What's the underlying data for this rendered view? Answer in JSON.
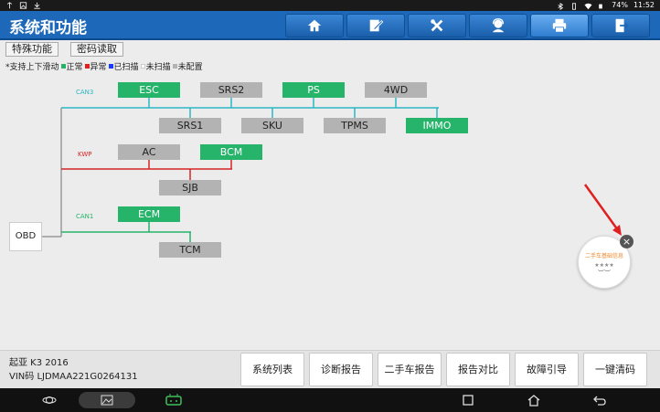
{
  "statusbar": {
    "battery": "74%",
    "time": "11:52"
  },
  "header": {
    "title": "系统和功能",
    "buttons": [
      {
        "icon": "home-icon"
      },
      {
        "icon": "edit-report-icon"
      },
      {
        "icon": "tools-icon"
      },
      {
        "icon": "support-agent-icon"
      },
      {
        "icon": "print-icon"
      },
      {
        "icon": "exit-icon"
      }
    ]
  },
  "tabs": {
    "special": "特殊功能",
    "code_read": "密码读取"
  },
  "legend": {
    "scroll": "*支持上下滑动",
    "normal": "正常",
    "abnormal": "异常",
    "scanned": "已扫描",
    "not_scanned": "未扫描",
    "not_configured": "未配置",
    "colors": {
      "normal": "#26b36a",
      "abnormal": "#e02020",
      "scanned": "#1a3cff",
      "not_configured": "#b3b3b3"
    }
  },
  "diagram": {
    "obd": "OBD",
    "buses": {
      "can3": {
        "label": "CAN3",
        "color": "#2bb6c4"
      },
      "kwp": {
        "label": "KWP",
        "color": "#d42424"
      },
      "can1": {
        "label": "CAN1",
        "color": "#26b36a"
      }
    },
    "modules": {
      "esc": {
        "label": "ESC",
        "status": "ok"
      },
      "srs2": {
        "label": "SRS2",
        "status": "na"
      },
      "ps": {
        "label": "PS",
        "status": "ok"
      },
      "fourwd": {
        "label": "4WD",
        "status": "na"
      },
      "srs1": {
        "label": "SRS1",
        "status": "na"
      },
      "sku": {
        "label": "SKU",
        "status": "na"
      },
      "tpms": {
        "label": "TPMS",
        "status": "na"
      },
      "immo": {
        "label": "IMMO",
        "status": "ok"
      },
      "ac": {
        "label": "AC",
        "status": "na"
      },
      "bcm": {
        "label": "BCM",
        "status": "ok"
      },
      "sjb": {
        "label": "SJB",
        "status": "na"
      },
      "ecm": {
        "label": "ECM",
        "status": "ok"
      },
      "tcm": {
        "label": "TCM",
        "status": "na"
      }
    }
  },
  "float_widget": {
    "text": "二手车基础信息",
    "stars": "★★★★",
    "eye": "︶︶"
  },
  "vehicle": {
    "model": "起亚 K3 2016",
    "vin": "VIN码 LJDMAA221G0264131"
  },
  "footer_buttons": {
    "system_list": "系统列表",
    "diag_report": "诊断报告",
    "used_car_report": "二手车报告",
    "report_compare": "报告对比",
    "fault_guide": "故障引导",
    "one_key_clear": "一键清码"
  }
}
